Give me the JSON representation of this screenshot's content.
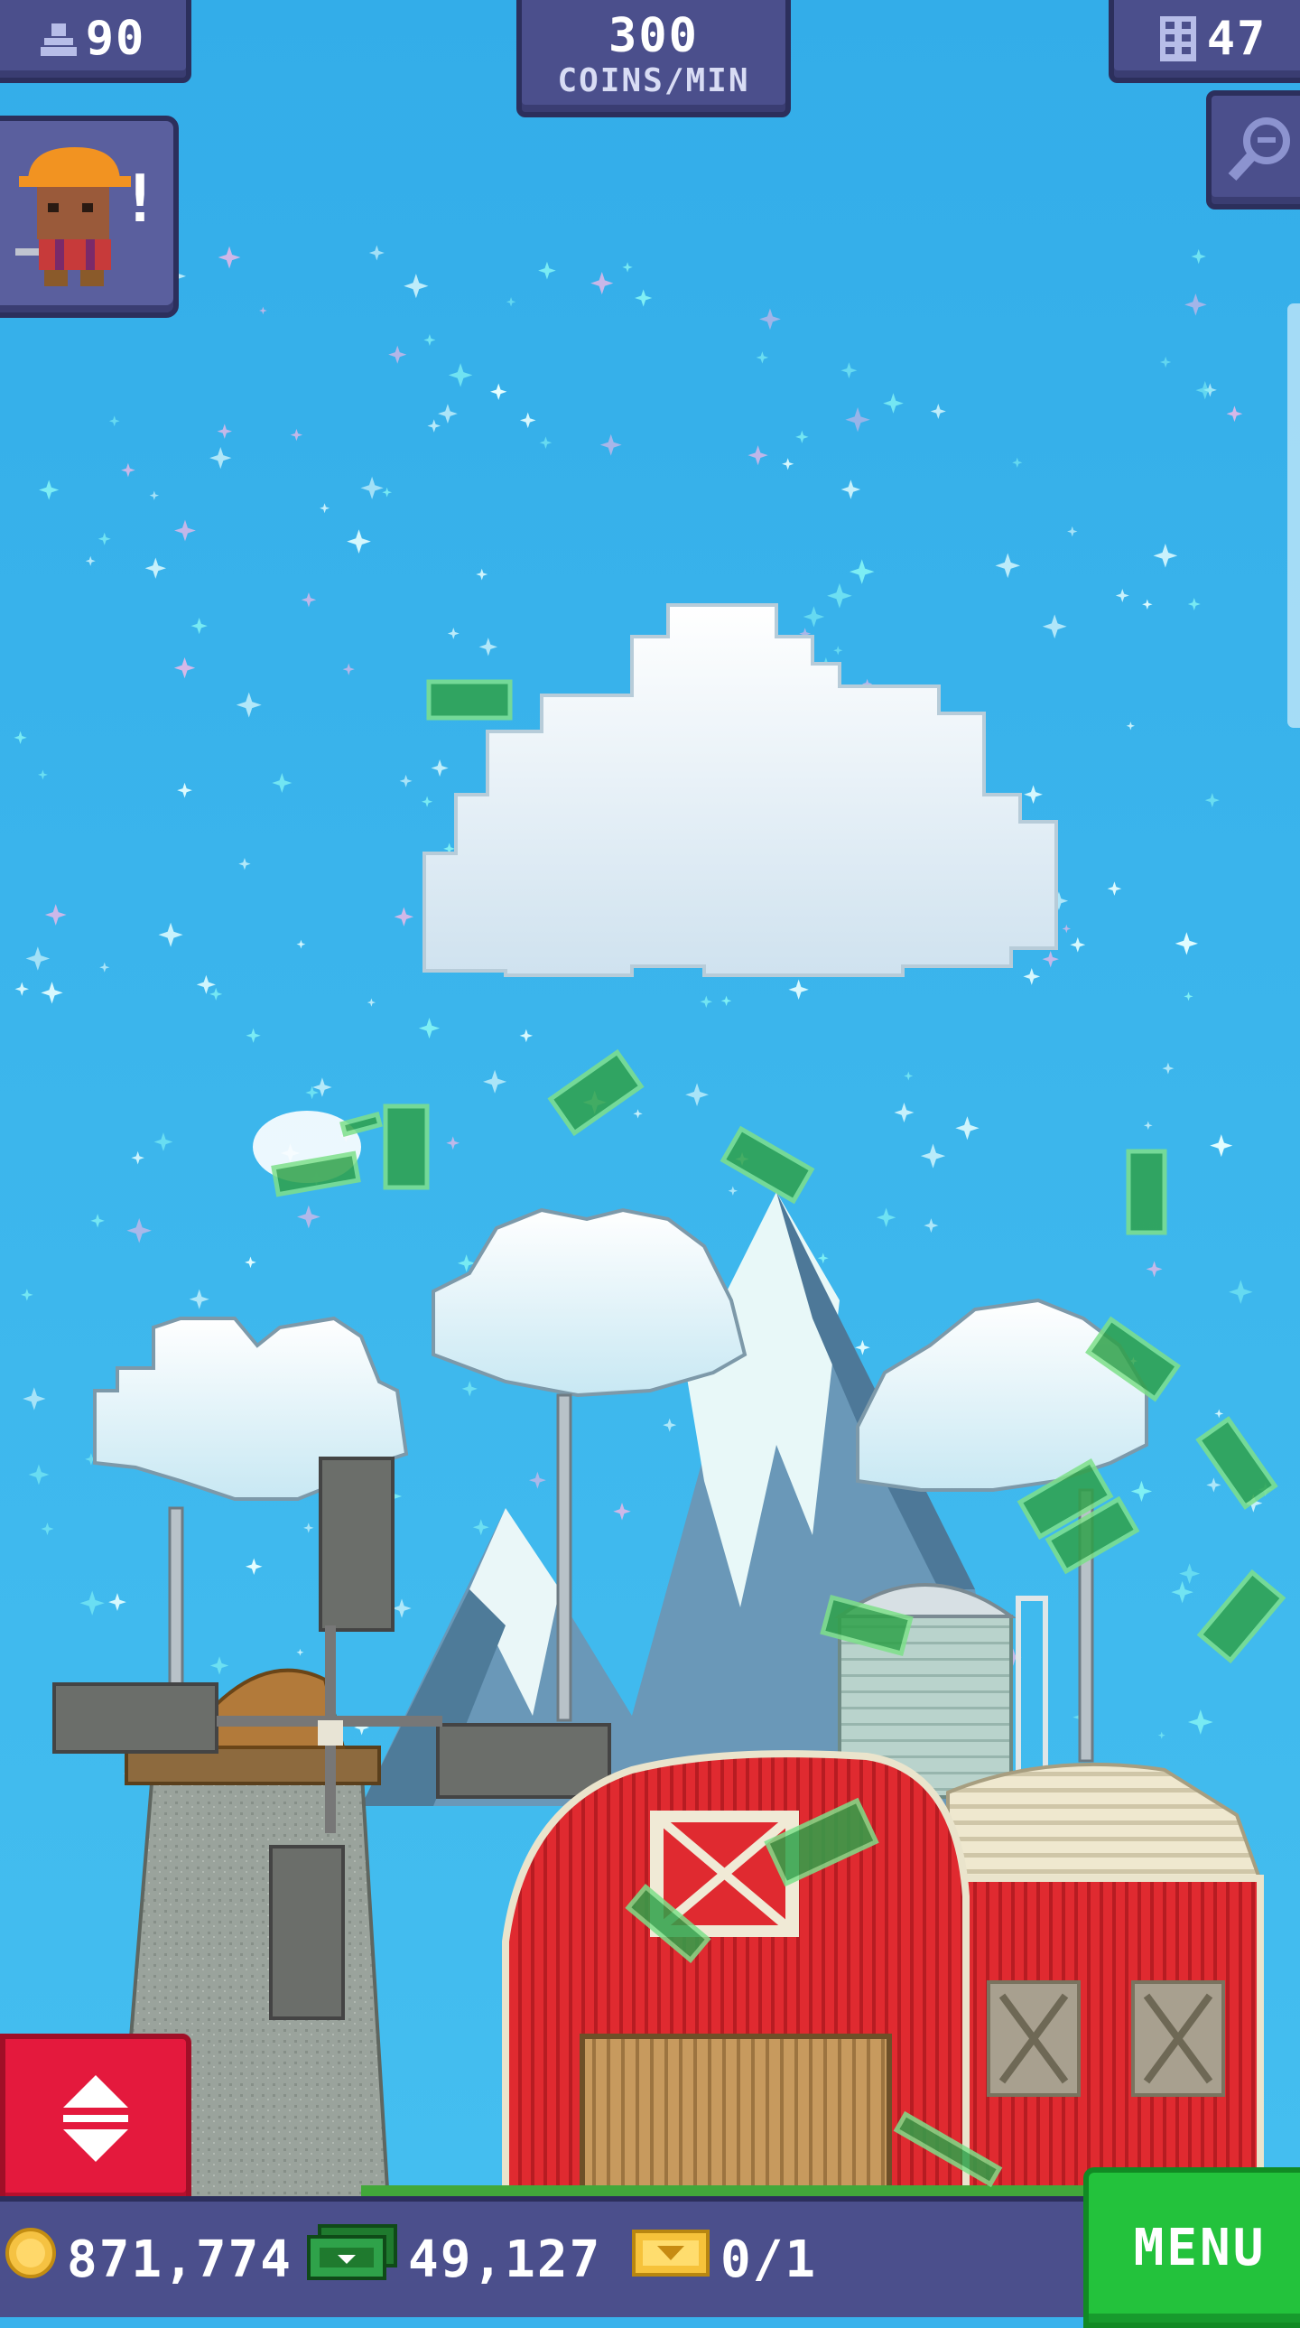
{
  "hud": {
    "population": {
      "icon": "bitizen-icon",
      "value": "90"
    },
    "income": {
      "value": "300",
      "unit": "COINS/MIN"
    },
    "floors": {
      "icon": "floors-icon",
      "value": "47"
    },
    "search": {
      "icon": "magnifier-icon"
    },
    "notification": {
      "icon": "construction-worker-icon",
      "badge": "!"
    }
  },
  "resources": {
    "coins": {
      "icon": "coin-icon",
      "value": "871,774"
    },
    "tower_bux": {
      "icon": "bux-icon",
      "value": "49,127"
    },
    "golden_tickets": {
      "icon": "golden-ticket-icon",
      "value": "0/1"
    }
  },
  "controls": {
    "elevator_icon": "up-down-arrows-icon",
    "menu_label": "MENU"
  },
  "colors": {
    "sky": "#39b2ec",
    "hud_panel": "#4b4f8c",
    "elevator_button": "#e4193d",
    "menu_button": "#23c23c",
    "barn_red": "#d9252c"
  }
}
